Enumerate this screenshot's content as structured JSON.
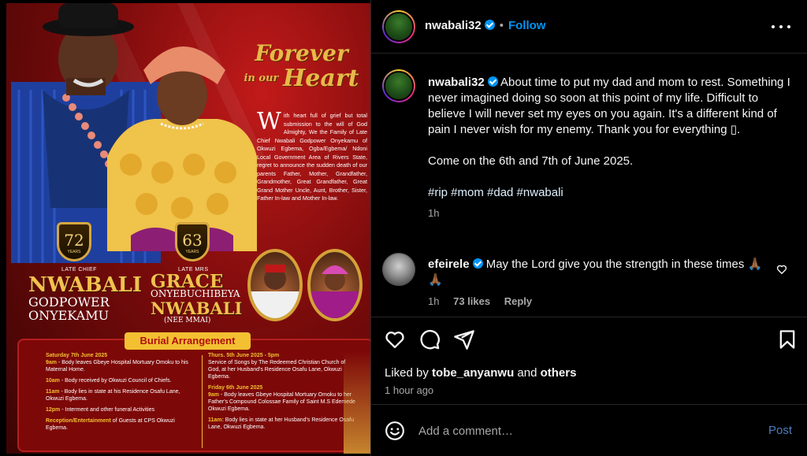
{
  "poster": {
    "forever_l1": "Forever",
    "forever_l2": "in our",
    "forever_l3": "Heart",
    "grief_dropcap": "W",
    "grief_text": "ith heart full of grief but total submission to the will of God Almighty, We the Family of Late Chief Nwabali Godpower Onyekamu of Okwuzi Egbema, Ogba/Egbema/ Ndoni Local Government Area of Rivers State, regret to announce the sudden death of our parents Father, Mother, Grandfather, Grandmother, Great Grandfather, Great Grand Mother Uncle, Aunt, Brother, Sister, Father In-law and Mother In-law.",
    "father": {
      "age": "72",
      "years": "YEARS",
      "late_label": "LATE CHIEF",
      "name1": "NWABALI",
      "name2": "GODPOWER",
      "name3": "ONYEKAMU"
    },
    "mother": {
      "age": "63",
      "years": "YEARS",
      "late_label": "LATE MRS",
      "name1": "GRACE",
      "name2": "ONYEBUCHIBEYA",
      "name3": "NWABALI",
      "nee": "(NEE MMAI)"
    },
    "burial_title": "Burial Arrangement",
    "left_schedule": {
      "day": "Saturday 7th June 2025",
      "e1_time": "9am",
      "e1_text": " - Body leaves Gbeye Hospital Mortuary Omoku to his Maternal Home.",
      "e2_time": "10am",
      "e2_text": " - Body received by Okwuzi Council of Chiefs.",
      "e3_time": "11am",
      "e3_text": " - Body lies in state at his Residence Osafu Lane, Okwuzi Egbema.",
      "e4_time": "12pm",
      "e4_text": " - Interment and other funeral Activities",
      "e5_time": "Reception/Entertainment",
      "e5_text": " of Guests at CPS Okwuzi Egbema."
    },
    "right_schedule": {
      "day1": "Thurs. 5th June 2025 - 5pm",
      "d1_text": "Service of Songs by The Redeemed Christian Church of God, at her Husband's Residence Osafu Lane, Okwuzi Egbema.",
      "day2": "Friday 6th June 2025",
      "d2_time": "9am",
      "d2_text": " - Body leaves Gbeye Hospital Mortuary Omoku to her Father's Compound Colossae Family of Saint M.S Edemede Okwuzi Egbema.",
      "d3_time": "11am:",
      "d3_text": " Body lies in state at her Husband's Residence Osafu Lane, Okwuzi Egbema."
    }
  },
  "header": {
    "username": "nwabali32",
    "follow_label": "Follow",
    "dot": "•"
  },
  "caption": {
    "username": "nwabali32",
    "text1": "About time to put my dad and mom to rest. Something I never imagined doing so soon at this point of my life. Difficult to believe I will never set my eyes on you again. It's a different kind of pain I never wish for my enemy. Thank you for everything ▯.",
    "text2": "Come on the 6th and 7th of June 2025.",
    "hashtags": "#rip #mom #dad #nwabali",
    "time": "1h"
  },
  "comment": {
    "username": "efeirele",
    "text": "May the Lord give you the strength in these times 🙏🏾🙏🏾",
    "time": "1h",
    "likes": "73 likes",
    "reply": "Reply"
  },
  "likes": {
    "prefix": "Liked by ",
    "user": "tobe_anyanwu",
    "mid": " and ",
    "others": "others",
    "time": "1 hour ago"
  },
  "add_comment": {
    "placeholder": "Add a comment…",
    "post_label": "Post"
  },
  "colors": {
    "accent": "#0095f6",
    "background": "#000000",
    "poster_red": "#7a0b0b",
    "gold": "#f2c14e"
  }
}
